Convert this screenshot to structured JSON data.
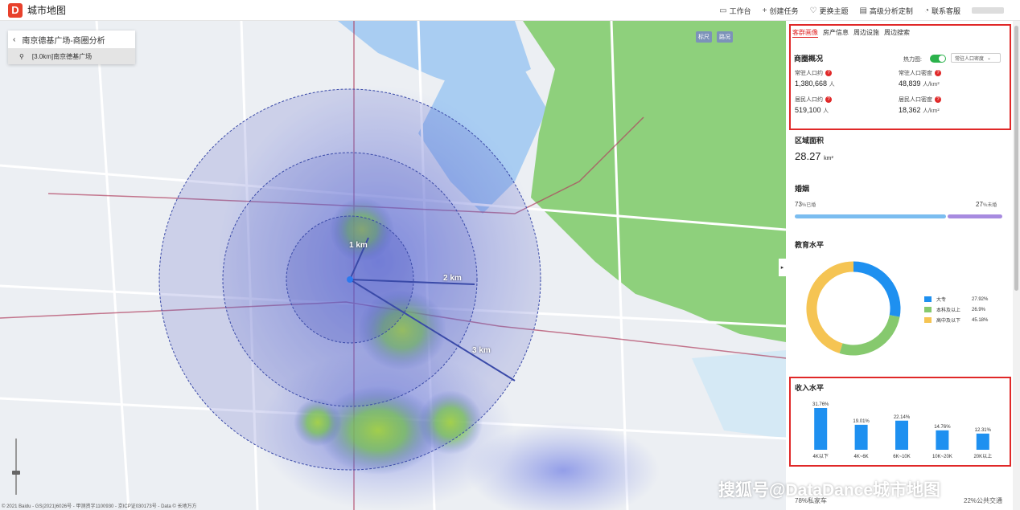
{
  "app": {
    "logo_letter": "D",
    "title": "城市地图"
  },
  "top_actions": [
    {
      "label": "工作台",
      "icon": "monitor-icon"
    },
    {
      "label": "创建任务",
      "icon": "plus-icon"
    },
    {
      "label": "更换主题",
      "icon": "shirt-icon"
    },
    {
      "label": "高级分析定制",
      "icon": "calendar-icon"
    },
    {
      "label": "联系客服",
      "icon": "headset-icon"
    }
  ],
  "search": {
    "back_icon": "chevron-left-icon",
    "title": "南京德基广场-商圈分析",
    "result": "[3.0km]南京德基广场"
  },
  "map": {
    "buttons": [
      "标尺",
      "路况"
    ],
    "rings": [
      "1 km",
      "2 km",
      "3 km"
    ],
    "copyright": "© 2021 Baidu - GS(2021)6026号 - 甲测资字1100930 - 京ICP证030173号 - Data © 长地万方"
  },
  "panel": {
    "tabs": [
      "客群画像",
      "房产信息",
      "周边设施",
      "周边搜索"
    ],
    "active_tab": 0,
    "overview": {
      "title": "商圈概况",
      "heatmap_label": "热力图:",
      "heatmap_select": "常驻人口密度",
      "stats": [
        {
          "label": "常驻人口约",
          "value": "1,380,668",
          "unit": "人"
        },
        {
          "label": "常驻人口密度",
          "value": "48,839",
          "unit": "人/km²"
        },
        {
          "label": "居民人口约",
          "value": "519,100",
          "unit": "人"
        },
        {
          "label": "居民人口密度",
          "value": "18,362",
          "unit": "人/km²"
        }
      ]
    },
    "area": {
      "title": "区域面积",
      "value": "28.27",
      "unit": "km²"
    },
    "marriage": {
      "title": "婚姻",
      "married_pct": "73",
      "married_label": "%已婚",
      "unmarried_pct": "27",
      "unmarried_label": "%未婚",
      "married_fraction": 0.73,
      "colors": {
        "married": "#7bbdf0",
        "unmarried": "#a78be0"
      }
    },
    "education": {
      "title": "教育水平",
      "segments": [
        {
          "name": "大专",
          "pct": "27.92%",
          "value": 27.92,
          "color": "#1e90f0"
        },
        {
          "name": "本科及以上",
          "pct": "26.9%",
          "value": 26.9,
          "color": "#86c96e"
        },
        {
          "name": "高中及以下",
          "pct": "45.18%",
          "value": 45.18,
          "color": "#f5c453"
        }
      ]
    },
    "income": {
      "title": "收入水平",
      "bar_color": "#1e90f0",
      "categories": [
        "4K以下",
        "4K~6K",
        "6K~10K",
        "10K~20K",
        "20K以上"
      ],
      "labels": [
        "31.76%",
        "19.01%",
        "22.14%",
        "14.76%",
        "12.31%"
      ],
      "values": [
        31.76,
        19.01,
        22.14,
        14.76,
        12.31
      ]
    },
    "bottom": {
      "left": "78%私家车",
      "right": "22%公共交通"
    }
  },
  "watermark": "搜狐号@DataDance城市地图",
  "chart_data": [
    {
      "type": "pie",
      "title": "教育水平",
      "categories": [
        "大专",
        "本科及以上",
        "高中及以下"
      ],
      "values": [
        27.92,
        26.9,
        45.18
      ]
    },
    {
      "type": "bar",
      "title": "收入水平",
      "categories": [
        "4K以下",
        "4K~6K",
        "6K~10K",
        "10K~20K",
        "20K以上"
      ],
      "values": [
        31.76,
        19.01,
        22.14,
        14.76,
        12.31
      ]
    }
  ]
}
